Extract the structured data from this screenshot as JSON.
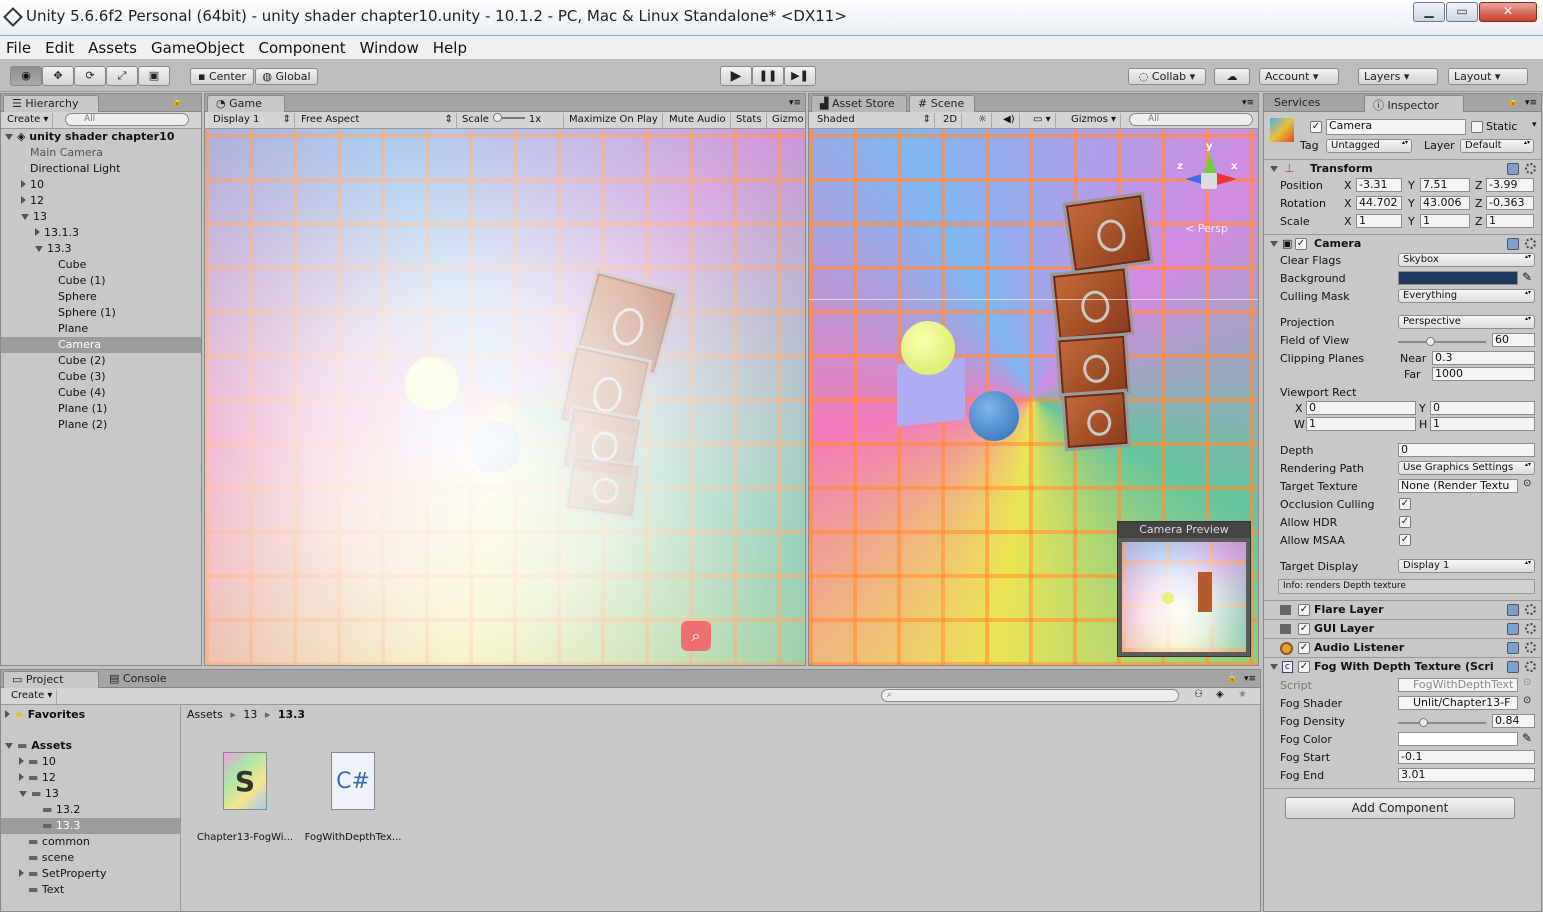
{
  "window": {
    "title": "Unity 5.6.6f2 Personal (64bit) - unity shader chapter10.unity - 10.1.2 - PC, Mac & Linux Standalone* <DX11>",
    "minimize": "▁",
    "maximize": "▭",
    "close": "✕"
  },
  "menu": [
    "File",
    "Edit",
    "Assets",
    "GameObject",
    "Component",
    "Window",
    "Help"
  ],
  "toolbar": {
    "center": "Center",
    "global": "Global",
    "collab": "Collab",
    "account": "Account",
    "layers": "Layers",
    "layout": "Layout",
    "play": "▶",
    "pause": "❚❚",
    "step": "▶❚"
  },
  "hierarchy": {
    "tab": "Hierarchy",
    "create": "Create",
    "search_placeholder": "All",
    "scene": "unity shader chapter10",
    "items": [
      {
        "label": "Main Camera",
        "indent": 1,
        "arrow": "none",
        "dim": true
      },
      {
        "label": "Directional Light",
        "indent": 1,
        "arrow": "none"
      },
      {
        "label": "10",
        "indent": 1,
        "arrow": "closed"
      },
      {
        "label": "12",
        "indent": 1,
        "arrow": "closed"
      },
      {
        "label": "13",
        "indent": 1,
        "arrow": "open"
      },
      {
        "label": "13.1.3",
        "indent": 2,
        "arrow": "closed"
      },
      {
        "label": "13.3",
        "indent": 2,
        "arrow": "open"
      },
      {
        "label": "Cube",
        "indent": 3,
        "arrow": "none"
      },
      {
        "label": "Cube (1)",
        "indent": 3,
        "arrow": "none"
      },
      {
        "label": "Sphere",
        "indent": 3,
        "arrow": "none"
      },
      {
        "label": "Sphere (1)",
        "indent": 3,
        "arrow": "none"
      },
      {
        "label": "Plane",
        "indent": 3,
        "arrow": "none"
      },
      {
        "label": "Camera",
        "indent": 3,
        "arrow": "none",
        "selected": true
      },
      {
        "label": "Cube (2)",
        "indent": 3,
        "arrow": "none"
      },
      {
        "label": "Cube (3)",
        "indent": 3,
        "arrow": "none"
      },
      {
        "label": "Cube (4)",
        "indent": 3,
        "arrow": "none"
      },
      {
        "label": "Plane (1)",
        "indent": 3,
        "arrow": "none"
      },
      {
        "label": "Plane (2)",
        "indent": 3,
        "arrow": "none"
      }
    ]
  },
  "game": {
    "tab": "Game",
    "display": "Display 1",
    "aspect": "Free Aspect",
    "scale_label": "Scale",
    "scale_value": "1x",
    "maximize_on_play": "Maximize On Play",
    "mute_audio": "Mute Audio",
    "stats": "Stats",
    "gizmos": "Gizmo"
  },
  "scene": {
    "asset_store_tab": "Asset Store",
    "tab": "Scene",
    "shading": "Shaded",
    "mode_2d": "2D",
    "gizmos": "Gizmos",
    "search_placeholder": "All",
    "persp": "< Persp",
    "axis_y": "y",
    "axis_x": "x",
    "axis_z": "z",
    "camera_preview": "Camera Preview"
  },
  "inspector": {
    "services_tab": "Services",
    "tab": "Inspector",
    "object_name": "Camera",
    "static_label": "Static",
    "tag_label": "Tag",
    "tag_value": "Untagged",
    "layer_label": "Layer",
    "layer_value": "Default",
    "transform": {
      "title": "Transform",
      "position": {
        "label": "Position",
        "x": "-3.31",
        "y": "7.51",
        "z": "-3.99"
      },
      "rotation": {
        "label": "Rotation",
        "x": "44.702",
        "y": "43.006",
        "z": "-0.363"
      },
      "scale": {
        "label": "Scale",
        "x": "1",
        "y": "1",
        "z": "1"
      }
    },
    "camera": {
      "title": "Camera",
      "clear_flags_label": "Clear Flags",
      "clear_flags": "Skybox",
      "background_label": "Background",
      "background_color": "#1f3a5e",
      "culling_mask_label": "Culling Mask",
      "culling_mask": "Everything",
      "projection_label": "Projection",
      "projection": "Perspective",
      "fov_label": "Field of View",
      "fov": "60",
      "fov_fraction": 0.36,
      "clipping_label": "Clipping Planes",
      "near_label": "Near",
      "near": "0.3",
      "far_label": "Far",
      "far": "1000",
      "viewport_label": "Viewport Rect",
      "vx_label": "X",
      "vx": "0",
      "vy_label": "Y",
      "vy": "0",
      "vw_label": "W",
      "vw": "1",
      "vh_label": "H",
      "vh": "1",
      "depth_label": "Depth",
      "depth": "0",
      "rendering_path_label": "Rendering Path",
      "rendering_path": "Use Graphics Settings",
      "target_texture_label": "Target Texture",
      "target_texture": "None (Render Textu",
      "occlusion_label": "Occlusion Culling",
      "hdr_label": "Allow HDR",
      "msaa_label": "Allow MSAA",
      "target_display_label": "Target Display",
      "target_display": "Display 1",
      "info": "Info: renders Depth texture"
    },
    "flare_layer": "Flare Layer",
    "gui_layer": "GUI Layer",
    "audio_listener": "Audio Listener",
    "fog": {
      "title": "Fog With Depth Texture (Scri",
      "script_label": "Script",
      "script": "FogWithDepthText",
      "shader_label": "Fog Shader",
      "shader": "Unlit/Chapter13-F",
      "density_label": "Fog Density",
      "density": "0.84",
      "density_fraction": 0.28,
      "color_label": "Fog Color",
      "color": "#ffffff",
      "start_label": "Fog Start",
      "start": "-0.1",
      "end_label": "Fog End",
      "end": "3.01"
    },
    "add_component": "Add Component"
  },
  "project": {
    "tab": "Project",
    "console_tab": "Console",
    "create": "Create",
    "favorites": "Favorites",
    "assets_root": "Assets",
    "folders": [
      {
        "label": "10",
        "indent": 1,
        "arrow": "closed"
      },
      {
        "label": "12",
        "indent": 1,
        "arrow": "closed"
      },
      {
        "label": "13",
        "indent": 1,
        "arrow": "open"
      },
      {
        "label": "13.2",
        "indent": 2,
        "arrow": "none"
      },
      {
        "label": "13.3",
        "indent": 2,
        "arrow": "none",
        "selected": true
      },
      {
        "label": "common",
        "indent": 1,
        "arrow": "none"
      },
      {
        "label": "scene",
        "indent": 1,
        "arrow": "none"
      },
      {
        "label": "SetProperty",
        "indent": 1,
        "arrow": "closed"
      },
      {
        "label": "Text",
        "indent": 1,
        "arrow": "none"
      }
    ],
    "breadcrumb": [
      "Assets",
      "13",
      "13.3"
    ],
    "assets": [
      {
        "label": "Chapter13-FogWi...",
        "kind": "shader",
        "glyph": "S"
      },
      {
        "label": "FogWithDepthTex...",
        "kind": "script",
        "glyph": "C#"
      }
    ]
  },
  "colors": {
    "editor_bg": "#c2c2c2",
    "panel_bg": "#c8c8c8",
    "selection": "#9c9c9c",
    "accent_blue": "#3b6fb6"
  }
}
